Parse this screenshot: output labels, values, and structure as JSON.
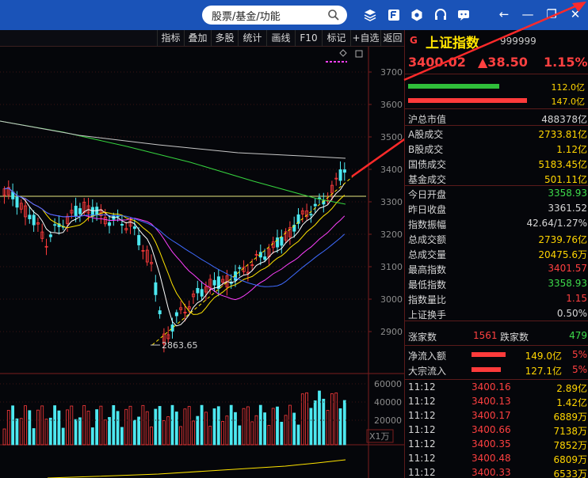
{
  "titlebar": {
    "search_text": "股票/基金/功能",
    "bg_color": "#1a53b8",
    "icons": [
      "layers-icon",
      "f10-icon",
      "hexagon-icon",
      "headset-icon",
      "chat-icon"
    ],
    "window_buttons": [
      "back-icon",
      "minimize-icon",
      "restore-icon",
      "close-icon"
    ]
  },
  "toolbar": {
    "items": [
      "指标",
      "叠加",
      "多股",
      "统计",
      "画线",
      "F10",
      "标记",
      "+自选",
      "返回"
    ]
  },
  "chart": {
    "y_labels": [
      "3700",
      "3600",
      "3500",
      "3400",
      "3300",
      "3200",
      "3100",
      "3000",
      "2900"
    ],
    "low_label": "2863.65",
    "vol_labels": [
      "60000",
      "40000",
      "20000"
    ],
    "vol_unit": "X1万",
    "colors": {
      "up": "#ff3b3b",
      "down": "#4de8f0",
      "ma5": "#ffffff",
      "ma10": "#ffe400",
      "ma20": "#ff40ff",
      "ma30": "#3f6bff",
      "ma60": "#36d43f",
      "ma120": "#c8c8c8",
      "hline": "#e8e880",
      "trend": "#ffe400"
    }
  },
  "index": {
    "flag": "G",
    "name": "上证指数",
    "code": "999999",
    "price": "3400.02",
    "change": "▲38.50",
    "pct": "1.15%"
  },
  "bars": [
    {
      "value": "112.0亿",
      "color": "#2fbf3a",
      "fill": 0.49
    },
    {
      "value": "147.0亿",
      "color": "#ff3b3b",
      "fill": 0.64
    }
  ],
  "stats": [
    {
      "label": "沪总市值",
      "value": "488378亿",
      "color": "#d6d6d6"
    },
    {
      "label": "A股成交",
      "value": "2733.81亿",
      "color": "#ffd500"
    },
    {
      "label": "B股成交",
      "value": "1.12亿",
      "color": "#ffd500"
    },
    {
      "label": "国债成交",
      "value": "5183.45亿",
      "color": "#ffd500"
    },
    {
      "label": "基金成交",
      "value": "501.11亿",
      "color": "#ffd500"
    },
    {
      "label": "今日开盘",
      "value": "3358.93",
      "color": "#3ddc4a"
    },
    {
      "label": "昨日收盘",
      "value": "3361.52",
      "color": "#d6d6d6"
    },
    {
      "label": "指数振幅",
      "value": "42.64/1.27%",
      "color": "#d6d6d6"
    },
    {
      "label": "总成交额",
      "value": "2739.76亿",
      "color": "#ffd500"
    },
    {
      "label": "总成交量",
      "value": "20475.6万",
      "color": "#ffd500"
    },
    {
      "label": "最高指数",
      "value": "3401.57",
      "color": "#ff4040"
    },
    {
      "label": "最低指数",
      "value": "3358.93",
      "color": "#3ddc4a"
    },
    {
      "label": "指数量比",
      "value": "1.15",
      "color": "#ff4040"
    },
    {
      "label": "上证换手",
      "value": "0.50%",
      "color": "#d6d6d6"
    }
  ],
  "breadth": {
    "up_label": "涨家数",
    "up_value": "1561",
    "down_label": "跌家数",
    "down_value": "479"
  },
  "flows": [
    {
      "label": "净流入额",
      "value": "149.0亿",
      "pct": "5%",
      "fill": 0.6
    },
    {
      "label": "大宗流入",
      "value": "127.1亿",
      "pct": "5%",
      "fill": 0.52
    }
  ],
  "ticks": [
    {
      "time": "11:12",
      "price": "3400.16",
      "vol": "2.89亿"
    },
    {
      "time": "11:12",
      "price": "3400.13",
      "vol": "1.42亿"
    },
    {
      "time": "11:12",
      "price": "3400.17",
      "vol": "6889万"
    },
    {
      "time": "11:12",
      "price": "3400.66",
      "vol": "7138万"
    },
    {
      "time": "11:12",
      "price": "3400.35",
      "vol": "7852万"
    },
    {
      "time": "11:12",
      "price": "3400.48",
      "vol": "6809万"
    },
    {
      "time": "11:12",
      "price": "3400.33",
      "vol": "6533万"
    }
  ]
}
